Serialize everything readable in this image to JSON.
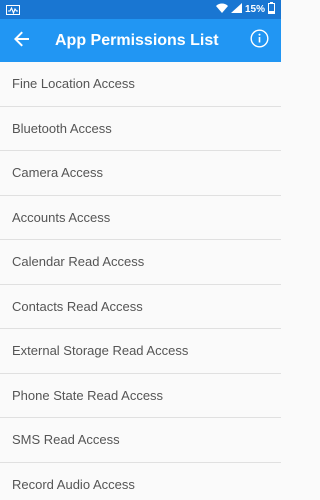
{
  "status_bar": {
    "battery_percent": "15%",
    "icons": [
      "activity-icon",
      "wifi-icon",
      "signal-icon",
      "battery-icon"
    ]
  },
  "app_bar": {
    "title": "App Permissions List",
    "back_icon": "arrow-left-icon",
    "info_icon": "info-icon"
  },
  "permissions": [
    "Fine Location Access",
    "Bluetooth Access",
    "Camera Access",
    "Accounts Access",
    "Calendar Read Access",
    "Contacts Read Access",
    "External Storage Read Access",
    "Phone State Read Access",
    "SMS Read Access",
    "Record Audio Access"
  ],
  "colors": {
    "status_bar": "#1976d2",
    "app_bar": "#2196f3",
    "background": "#fafafa",
    "divider": "#e0e0e0",
    "item_text": "#555555"
  }
}
